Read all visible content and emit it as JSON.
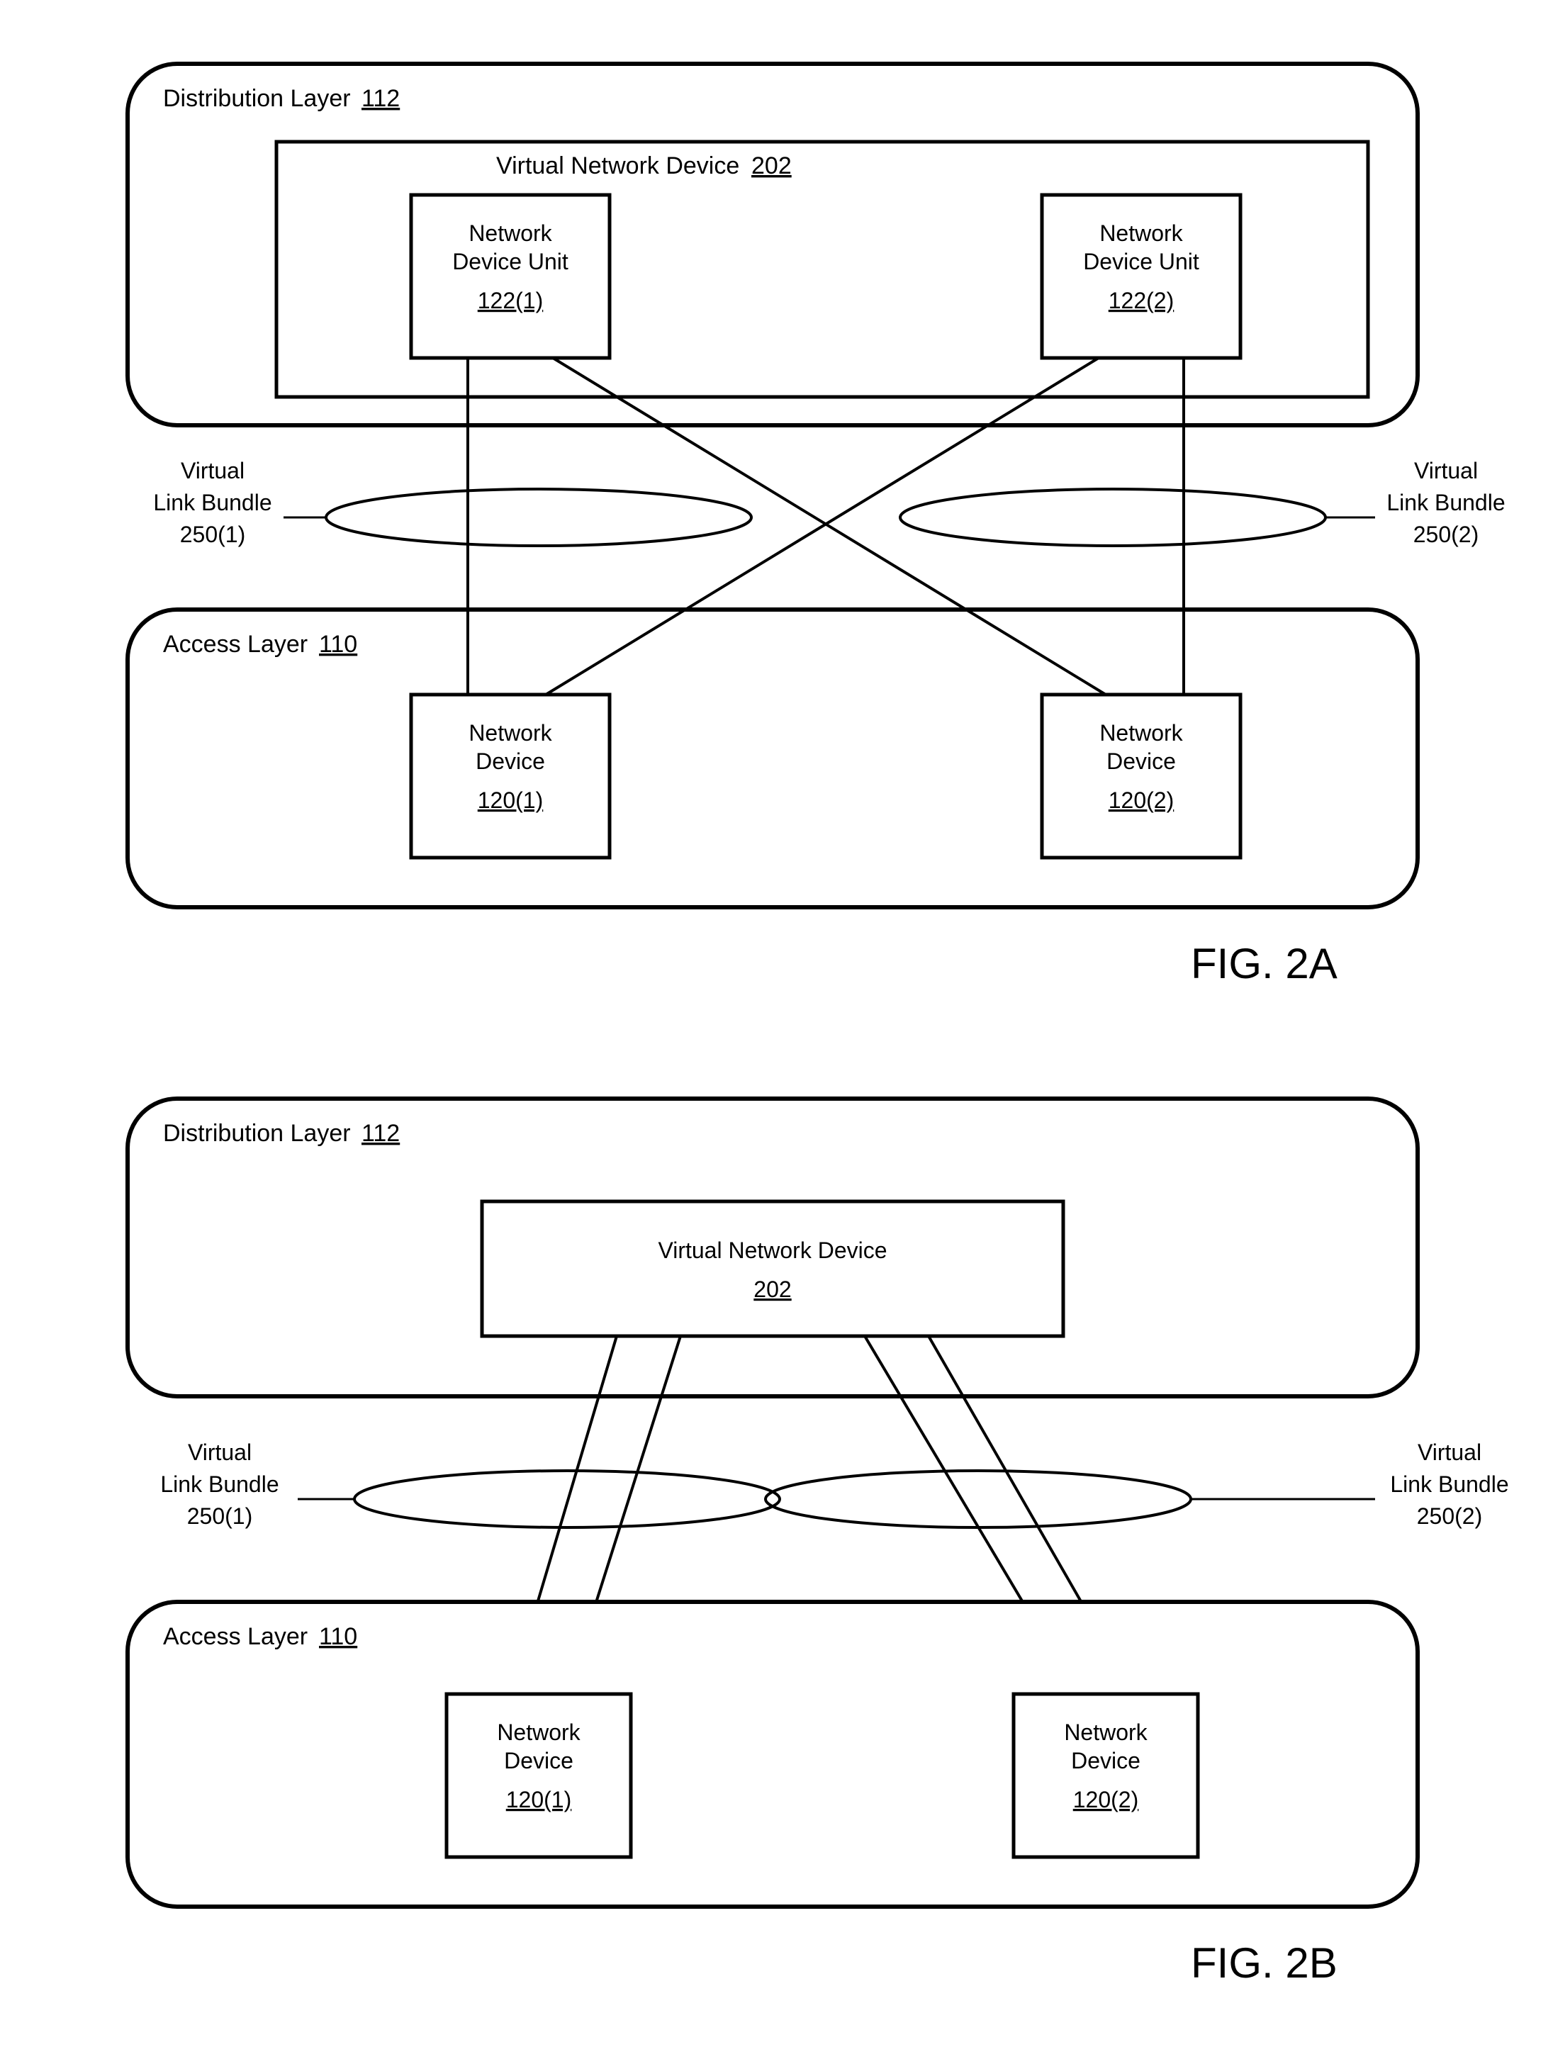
{
  "figA": {
    "distribution": {
      "label": "Distribution Layer",
      "ref": "112"
    },
    "vnd": {
      "label": "Virtual Network Device",
      "ref": "202"
    },
    "unit1": {
      "l1": "Network",
      "l2": "Device Unit",
      "ref": "122(1)"
    },
    "unit2": {
      "l1": "Network",
      "l2": "Device Unit",
      "ref": "122(2)"
    },
    "access": {
      "label": "Access Layer",
      "ref": "110"
    },
    "dev1": {
      "l1": "Network",
      "l2": "Device",
      "ref": "120(1)"
    },
    "dev2": {
      "l1": "Network",
      "l2": "Device",
      "ref": "120(2)"
    },
    "vlb1": {
      "l1": "Virtual",
      "l2": "Link Bundle",
      "ref": "250(1)"
    },
    "vlb2": {
      "l1": "Virtual",
      "l2": "Link Bundle",
      "ref": "250(2)"
    },
    "caption": "FIG. 2A"
  },
  "figB": {
    "distribution": {
      "label": "Distribution Layer",
      "ref": "112"
    },
    "vnd": {
      "l1": "Virtual Network Device",
      "ref": "202"
    },
    "access": {
      "label": "Access Layer",
      "ref": "110"
    },
    "dev1": {
      "l1": "Network",
      "l2": "Device",
      "ref": "120(1)"
    },
    "dev2": {
      "l1": "Network",
      "l2": "Device",
      "ref": "120(2)"
    },
    "vlb1": {
      "l1": "Virtual",
      "l2": "Link Bundle",
      "ref": "250(1)"
    },
    "vlb2": {
      "l1": "Virtual",
      "l2": "Link Bundle",
      "ref": "250(2)"
    },
    "caption": "FIG. 2B"
  }
}
